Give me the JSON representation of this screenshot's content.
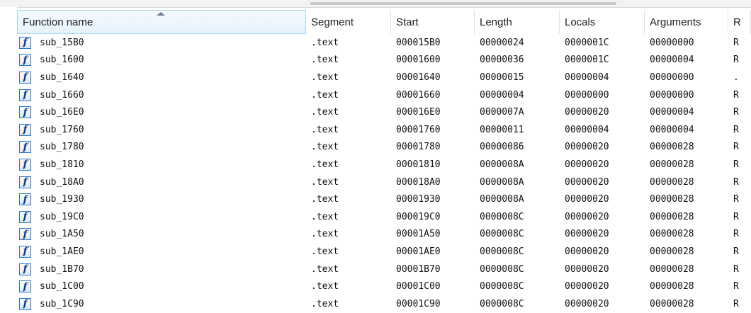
{
  "icons": {
    "function": "function-icon",
    "sort": "sort-ascending-icon"
  },
  "table": {
    "columns": [
      {
        "key": "name",
        "label": "Function name"
      },
      {
        "key": "segment",
        "label": "Segment"
      },
      {
        "key": "start",
        "label": "Start"
      },
      {
        "key": "length",
        "label": "Length"
      },
      {
        "key": "locals",
        "label": "Locals"
      },
      {
        "key": "arguments",
        "label": "Arguments"
      },
      {
        "key": "r",
        "label": "R"
      }
    ],
    "rows": [
      {
        "icon": "f",
        "name": "sub_15B0",
        "segment": ".text",
        "start": "000015B0",
        "length": "00000024",
        "locals": "0000001C",
        "arguments": "00000000",
        "r": "R"
      },
      {
        "icon": "f",
        "name": "sub_1600",
        "segment": ".text",
        "start": "00001600",
        "length": "00000036",
        "locals": "0000001C",
        "arguments": "00000004",
        "r": "R"
      },
      {
        "icon": "f",
        "name": "sub_1640",
        "segment": ".text",
        "start": "00001640",
        "length": "00000015",
        "locals": "00000004",
        "arguments": "00000000",
        "r": "."
      },
      {
        "icon": "f",
        "name": "sub_1660",
        "segment": ".text",
        "start": "00001660",
        "length": "00000004",
        "locals": "00000000",
        "arguments": "00000000",
        "r": "R"
      },
      {
        "icon": "f",
        "name": "sub_16E0",
        "segment": ".text",
        "start": "000016E0",
        "length": "0000007A",
        "locals": "00000020",
        "arguments": "00000004",
        "r": "R"
      },
      {
        "icon": "f",
        "name": "sub_1760",
        "segment": ".text",
        "start": "00001760",
        "length": "00000011",
        "locals": "00000004",
        "arguments": "00000004",
        "r": "R"
      },
      {
        "icon": "f",
        "name": "sub_1780",
        "segment": ".text",
        "start": "00001780",
        "length": "00000086",
        "locals": "00000020",
        "arguments": "00000028",
        "r": "R"
      },
      {
        "icon": "f",
        "name": "sub_1810",
        "segment": ".text",
        "start": "00001810",
        "length": "0000008A",
        "locals": "00000020",
        "arguments": "00000028",
        "r": "R"
      },
      {
        "icon": "f",
        "name": "sub_18A0",
        "segment": ".text",
        "start": "000018A0",
        "length": "0000008A",
        "locals": "00000020",
        "arguments": "00000028",
        "r": "R"
      },
      {
        "icon": "f",
        "name": "sub_1930",
        "segment": ".text",
        "start": "00001930",
        "length": "0000008A",
        "locals": "00000020",
        "arguments": "00000028",
        "r": "R"
      },
      {
        "icon": "f",
        "name": "sub_19C0",
        "segment": ".text",
        "start": "000019C0",
        "length": "0000008C",
        "locals": "00000020",
        "arguments": "00000028",
        "r": "R"
      },
      {
        "icon": "f",
        "name": "sub_1A50",
        "segment": ".text",
        "start": "00001A50",
        "length": "0000008C",
        "locals": "00000020",
        "arguments": "00000028",
        "r": "R"
      },
      {
        "icon": "f",
        "name": "sub_1AE0",
        "segment": ".text",
        "start": "00001AE0",
        "length": "0000008C",
        "locals": "00000020",
        "arguments": "00000028",
        "r": "R"
      },
      {
        "icon": "f",
        "name": "sub_1B70",
        "segment": ".text",
        "start": "00001B70",
        "length": "0000008C",
        "locals": "00000020",
        "arguments": "00000028",
        "r": "R"
      },
      {
        "icon": "f",
        "name": "sub_1C00",
        "segment": ".text",
        "start": "00001C00",
        "length": "0000008C",
        "locals": "00000020",
        "arguments": "00000028",
        "r": "R"
      },
      {
        "icon": "f",
        "name": "sub_1C90",
        "segment": ".text",
        "start": "00001C90",
        "length": "0000008C",
        "locals": "00000020",
        "arguments": "00000028",
        "r": "R"
      }
    ]
  }
}
